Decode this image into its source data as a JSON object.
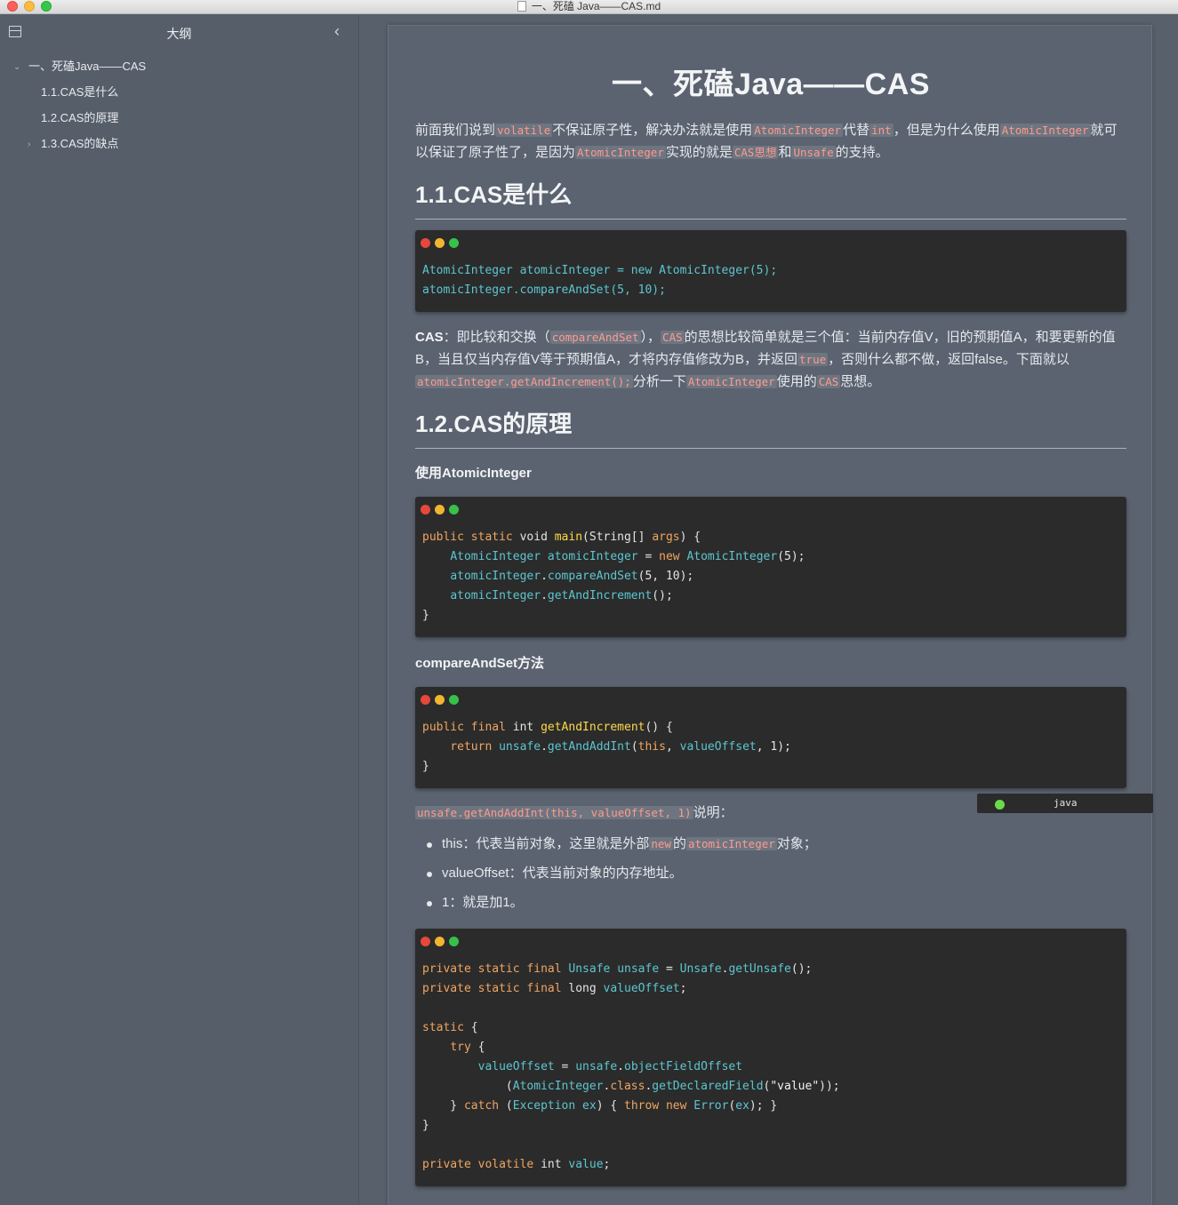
{
  "window": {
    "title": "一、死磕 Java——CAS.md"
  },
  "sidebar": {
    "title": "大纲",
    "items": [
      {
        "label": "一、死磕Java——CAS",
        "expanded": true
      },
      {
        "label": "1.1.CAS是什么"
      },
      {
        "label": "1.2.CAS的原理"
      },
      {
        "label": "1.3.CAS的缺点",
        "collapsed": true
      }
    ]
  },
  "doc": {
    "title": "一、死磕Java——CAS",
    "intro": {
      "t1": "前面我们说到",
      "c1": "volatile",
      "t2": "不保证原子性，解决办法就是使用",
      "c2": "AtomicInteger",
      "t3": "代替",
      "c3": "int",
      "t4": "，但是为什么使用",
      "c4": "AtomicInteger",
      "t5": "就可以保证了原子性了，是因为",
      "c5": "AtomicInteger",
      "t6": "实现的就是",
      "c6": "CAS思想",
      "t7": "和",
      "c7": "Unsafe",
      "t8": "的支持。"
    },
    "h_what": "1.1.CAS是什么",
    "code1": [
      "AtomicInteger atomicInteger = new AtomicInteger(5);",
      "atomicInteger.compareAndSet(5, 10);"
    ],
    "cas_para": {
      "t1": "CAS",
      "t2": "：即比较和交换（",
      "c1": "compareAndSet",
      "t3": "），",
      "c2": "CAS",
      "t4": "的思想比较简单就是三个值：当前内存值V，旧的预期值A，和要更新的值B，当且仅当内存值V等于预期值A，才将内存值修改为B，并返回",
      "c3": "true",
      "t5": "，否则什么都不做，返回false。下面就以",
      "c4": "atomicInteger.getAndIncrement();",
      "t6": "分析一下",
      "c5": "AtomicInteger",
      "t7": "使用的",
      "c6": "CAS",
      "t8": "思想。"
    },
    "h_principle": "1.2.CAS的原理",
    "h_use": "使用AtomicInteger",
    "h_cas_method": "compareAndSet方法",
    "lang_label": "java",
    "explain": {
      "code": "unsafe.getAndAddInt(this, valueOffset, 1)",
      "text": "说明："
    },
    "bullets": {
      "b1": {
        "t1": "this：代表当前对象，这里就是外部",
        "c1": "new",
        "t2": "的",
        "c2": "atomicInteger",
        "t3": "对象；"
      },
      "b2": "valueOffset：代表当前对象的内存地址。",
      "b3": "1：就是加1。"
    }
  }
}
